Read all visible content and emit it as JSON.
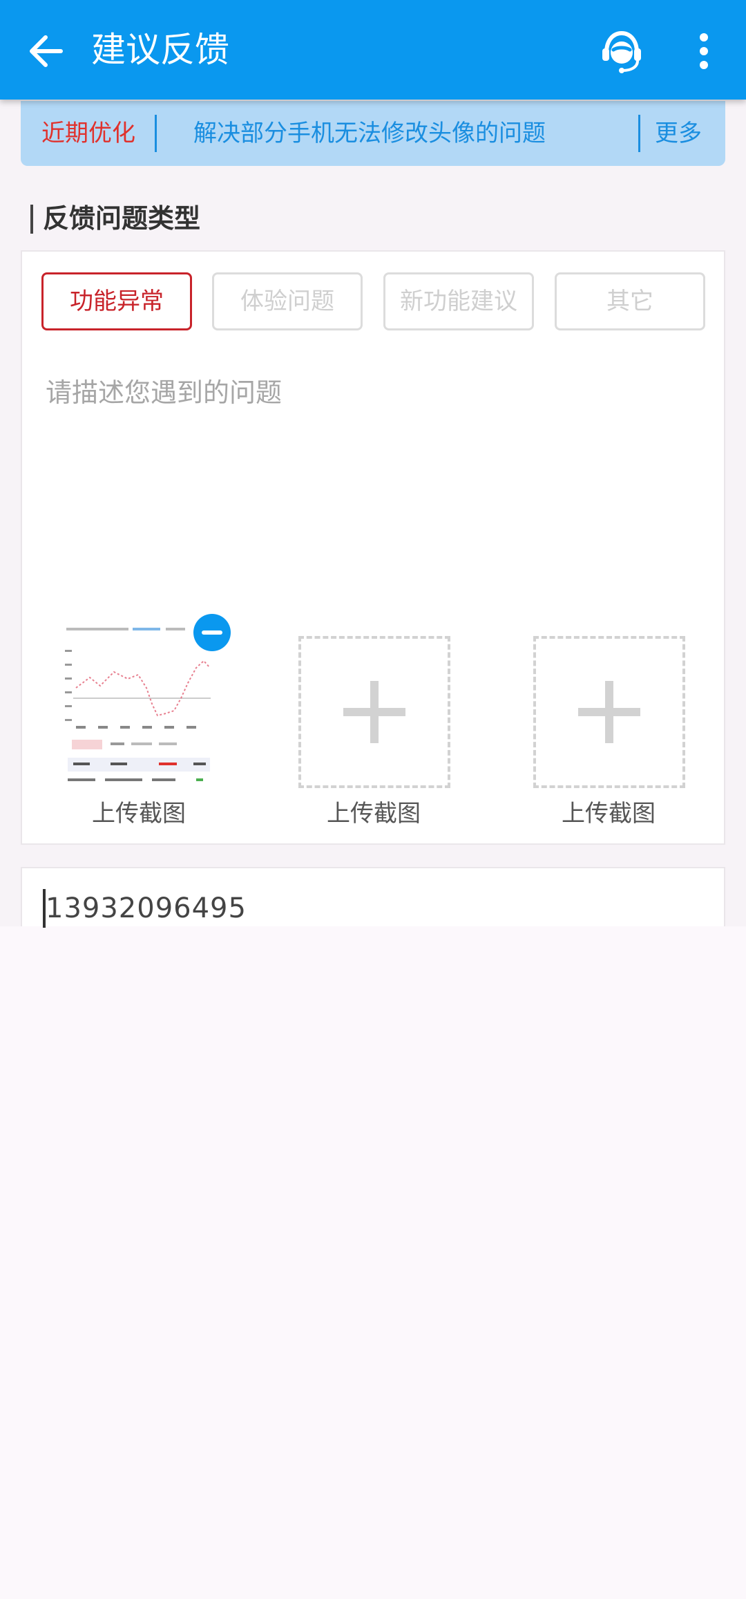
{
  "app_bar": {
    "title": "建议反馈",
    "back_icon": "arrow-left-icon",
    "service_icon": "customer-service-headset-icon",
    "more_icon": "more-vertical-icon",
    "color": "#0a98ef"
  },
  "notice": {
    "label": "近期优化",
    "text": "解决部分手机无法修改头像的问题",
    "more": "更多",
    "label_color": "#e0312c",
    "text_color": "#1a8ee0",
    "background": "#b2d8f6"
  },
  "section": {
    "title": "反馈问题类型"
  },
  "feedback_types": [
    {
      "label": "功能异常",
      "selected": true
    },
    {
      "label": "体验问题",
      "selected": false
    },
    {
      "label": "新功能建议",
      "selected": false
    },
    {
      "label": "其它",
      "selected": false
    }
  ],
  "description": {
    "placeholder": "请描述您遇到的问题"
  },
  "screenshots": [
    {
      "label": "上传截图",
      "state": "uploaded",
      "remove_icon": "minus-circle-icon"
    },
    {
      "label": "上传截图",
      "state": "empty",
      "add_icon": "plus-icon"
    },
    {
      "label": "上传截图",
      "state": "empty",
      "add_icon": "plus-icon"
    }
  ],
  "contact": {
    "value": "13932096495"
  }
}
